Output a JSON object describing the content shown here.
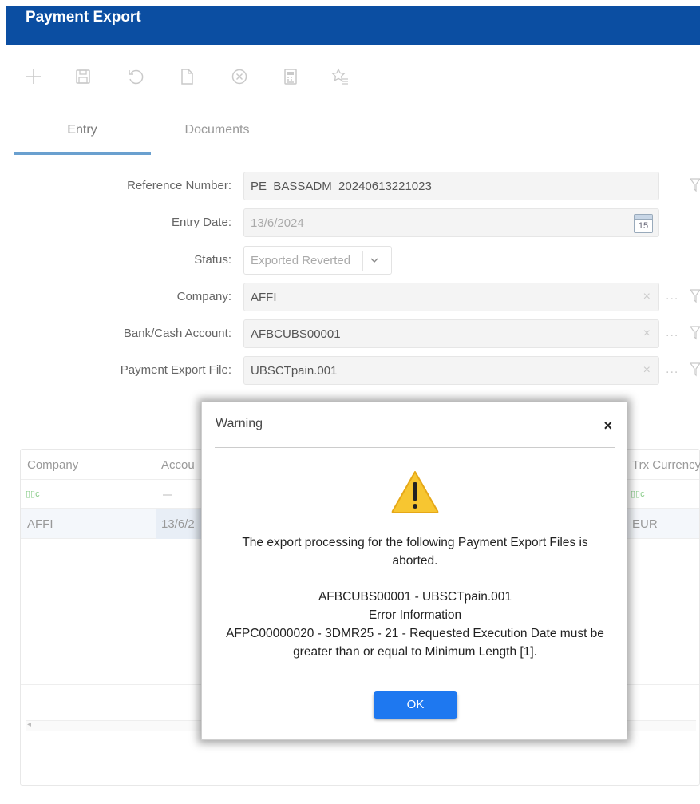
{
  "window": {
    "title": "Payment Export"
  },
  "toolbar": {
    "buttons": [
      {
        "name": "add",
        "icon": "plus-icon"
      },
      {
        "name": "save",
        "icon": "save-icon"
      },
      {
        "name": "undo",
        "icon": "undo-icon"
      },
      {
        "name": "new-document",
        "icon": "document-icon"
      },
      {
        "name": "cancel",
        "icon": "cancel-icon"
      },
      {
        "name": "calculate",
        "icon": "calculator-icon"
      },
      {
        "name": "favorite",
        "icon": "star-list-icon"
      }
    ]
  },
  "tabs": [
    {
      "label": "Entry",
      "active": true
    },
    {
      "label": "Documents",
      "active": false
    }
  ],
  "form": {
    "reference_number": {
      "label": "Reference Number:",
      "value": "PE_BASSADM_20240613221023"
    },
    "entry_date": {
      "label": "Entry Date:",
      "value": "13/6/2024",
      "calendar_day": "15"
    },
    "status": {
      "label": "Status:",
      "value": "Exported Reverted"
    },
    "company": {
      "label": "Company:",
      "value": "AFFI"
    },
    "bank_cash_account": {
      "label": "Bank/Cash Account:",
      "value": "AFBCUBS00001"
    },
    "payment_export_file": {
      "label": "Payment Export File:",
      "value": "UBSCTpain.001"
    },
    "clear_glyph": "×",
    "more_glyph": "..."
  },
  "grid": {
    "columns": [
      {
        "label": "Company"
      },
      {
        "label": "Accou"
      },
      {
        "label": "Trx Currency"
      }
    ],
    "filter_glyph": "▯▯c",
    "rows": [
      {
        "company": "AFFI",
        "account": "13/6/2",
        "trx_currency": "EUR"
      }
    ],
    "scroll_arrow": "◂"
  },
  "dialog": {
    "title": "Warning",
    "close_glyph": "×",
    "message_line1": "The export processing for the following Payment Export Files is",
    "message_line2": "aborted.",
    "detail_file": "AFBCUBS00001 - UBSCTpain.001",
    "detail_heading": "Error Information",
    "error_line1": "AFPC00000020 - 3DMR25 - 21 - Requested Execution Date must be",
    "error_line2": "greater than or equal to Minimum Length [1].",
    "ok_label": "OK"
  },
  "colors": {
    "titlebar": "#0b4ea2",
    "tab_underline": "#6aa0cf",
    "ok_button": "#1e78f0",
    "warning_yellow": "#f7c631"
  }
}
